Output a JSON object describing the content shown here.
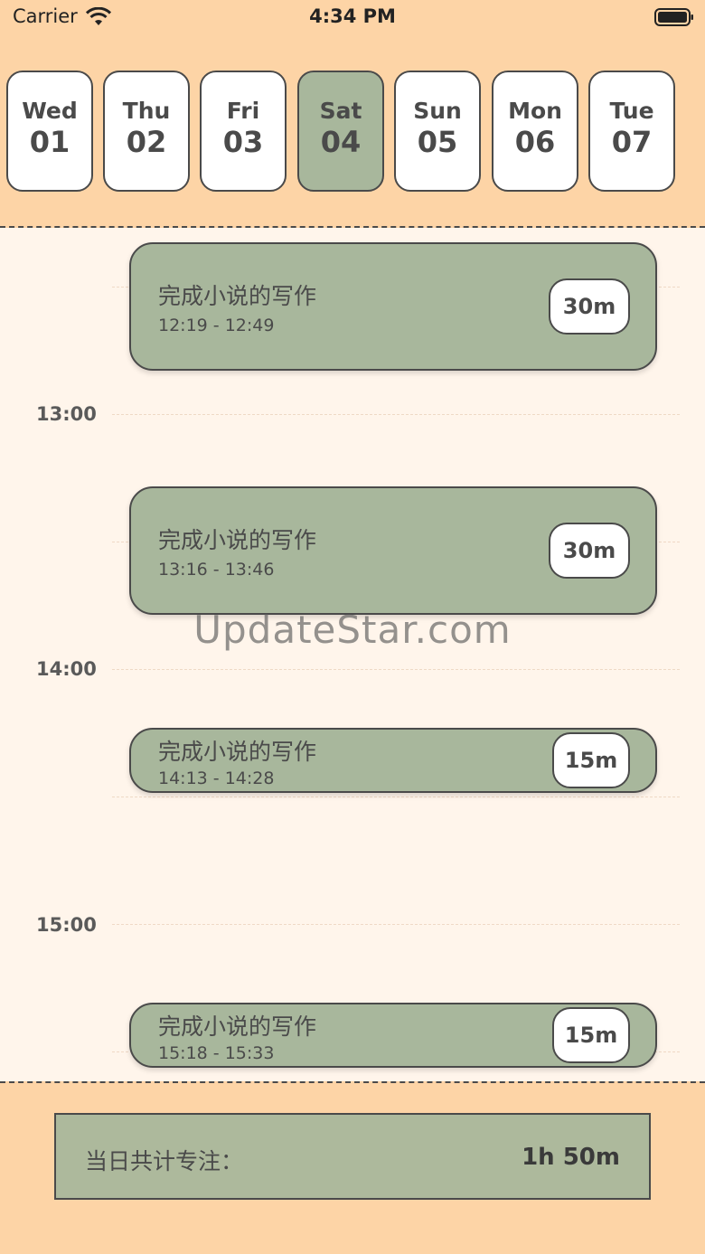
{
  "status_bar": {
    "carrier": "Carrier",
    "time": "4:34 PM"
  },
  "days": [
    {
      "name": "Wed",
      "num": "01",
      "selected": false
    },
    {
      "name": "Thu",
      "num": "02",
      "selected": false
    },
    {
      "name": "Fri",
      "num": "03",
      "selected": false
    },
    {
      "name": "Sat",
      "num": "04",
      "selected": true
    },
    {
      "name": "Sun",
      "num": "05",
      "selected": false
    },
    {
      "name": "Mon",
      "num": "06",
      "selected": false
    },
    {
      "name": "Tue",
      "num": "07",
      "selected": false
    }
  ],
  "hours": [
    "13:00",
    "14:00",
    "15:00"
  ],
  "sessions": [
    {
      "title": "完成小说的写作",
      "time": "12:19 - 12:49",
      "duration": "30m"
    },
    {
      "title": "完成小说的写作",
      "time": "13:16 - 13:46",
      "duration": "30m"
    },
    {
      "title": "完成小说的写作",
      "time": "14:13 - 14:28",
      "duration": "15m"
    },
    {
      "title": "完成小说的写作",
      "time": "15:18 - 15:33",
      "duration": "15m"
    }
  ],
  "watermark": "UpdateStar.com",
  "summary": {
    "label": "当日共计专注：",
    "value": "1h 50m"
  },
  "colors": {
    "header_bg": "#fdd4a6",
    "timeline_bg": "#fff5eb",
    "accent_green": "#a8b79c",
    "border": "#4a4a4a"
  }
}
